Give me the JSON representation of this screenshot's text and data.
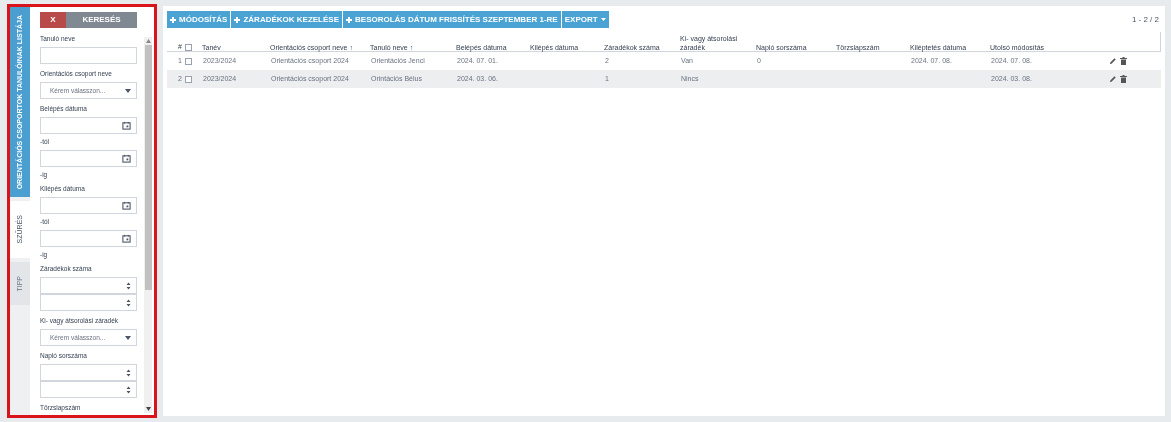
{
  "side_tabs": [
    {
      "label": "ORIENTÁCIÓS CSOPORTOK TANULÓINAK LISTÁJA",
      "selected": true,
      "disabled": false
    },
    {
      "label": "SZŰRÉS",
      "selected": false,
      "disabled": false
    },
    {
      "label": "TIPP",
      "selected": false,
      "disabled": true
    }
  ],
  "filter": {
    "clear_button": "X",
    "search_button": "KERESÉS",
    "fields": [
      {
        "kind": "text",
        "label": "Tanuló neve"
      },
      {
        "kind": "select",
        "label": "Orientációs csoport neve",
        "placeholder": "Kérem válasszon..."
      },
      {
        "kind": "date_range",
        "label": "Belépés dátuma",
        "suffixes": [
          "-tól",
          "-ig"
        ]
      },
      {
        "kind": "date_range",
        "label": "Kilépés dátuma",
        "suffixes": [
          "-tól",
          "-ig"
        ]
      },
      {
        "kind": "number_range",
        "label": "Záradékok száma"
      },
      {
        "kind": "select",
        "label": "Ki- vagy átsorolási záradék",
        "placeholder": "Kérem válasszon..."
      },
      {
        "kind": "number_range",
        "label": "Napló sorszáma"
      },
      {
        "kind": "text",
        "label": "Törzslapszám"
      }
    ]
  },
  "toolbar": {
    "buttons": [
      {
        "label": "MÓDOSÍTÁS",
        "kind": "plus"
      },
      {
        "label": "ZÁRADÉKOK KEZELÉSE",
        "kind": "plus"
      },
      {
        "label": "BESOROLÁS DÁTUM FRISSÍTÉS SZEPTEMBER 1-RE",
        "kind": "plus"
      },
      {
        "label": "EXPORT",
        "kind": "dropdown"
      }
    ],
    "pager": "1 - 2 / 2"
  },
  "table": {
    "number_header": "#",
    "all_selected": false,
    "columns": [
      {
        "label": "Tanév"
      },
      {
        "label": "Orientációs csoport neve",
        "sort_mark": "↑"
      },
      {
        "label": "Tanuló neve",
        "sort_mark": "↑"
      },
      {
        "label": "Belépés dátuma"
      },
      {
        "label": "Kilépés dátuma"
      },
      {
        "label": "Záradékok száma"
      },
      {
        "label": "Ki- vagy átsorolási záradék"
      },
      {
        "label": "Napló sorszáma"
      },
      {
        "label": "Törzslapszám"
      },
      {
        "label": "Kiléptetés dátuma"
      },
      {
        "label": "Utolsó módosítás"
      }
    ],
    "rows": [
      {
        "number": "1",
        "selected": false,
        "cells": [
          "2023/2024",
          "Orientációs csoport 2024",
          "Orientációs Jenci",
          "2024. 07. 01.",
          null,
          "2",
          "Van",
          "0",
          null,
          "2024. 07. 08.",
          "2024. 07. 08."
        ]
      },
      {
        "number": "2",
        "selected": false,
        "cells": [
          "2023/2024",
          "Orientációs csoport 2024",
          "Orintációs Bélus",
          "2024. 03. 06.",
          null,
          "1",
          "Nincs",
          null,
          null,
          null,
          "2024. 03. 08."
        ]
      }
    ]
  }
}
